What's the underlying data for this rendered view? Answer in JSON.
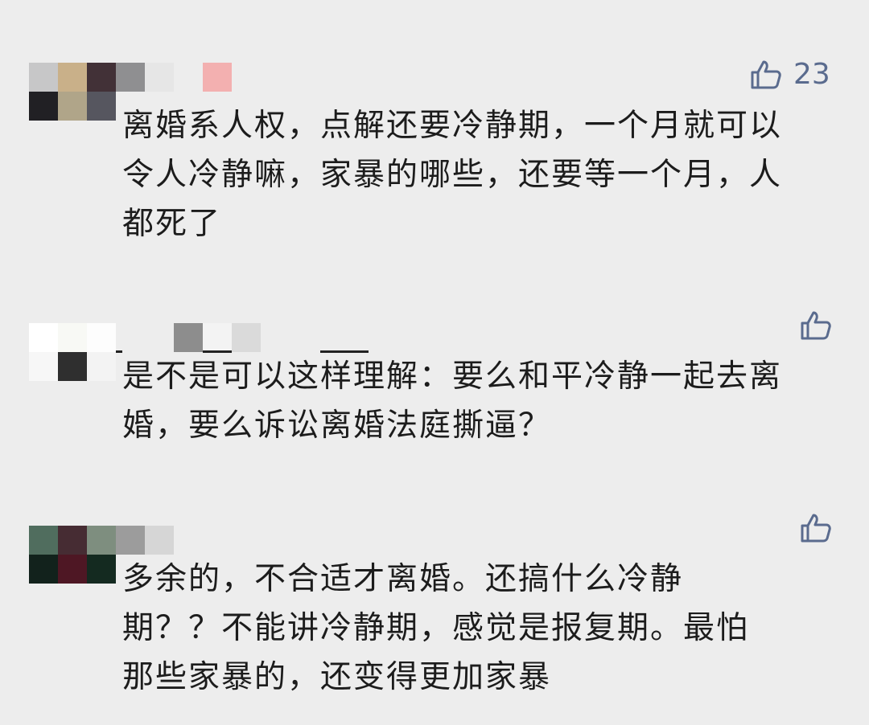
{
  "comments": [
    {
      "like_icon": "thumbs-up-icon",
      "like_count": "23",
      "text": "离婚系人权，点解还要冷静期，一个月就可以令人冷静嘛，家暴的哪些，还要等一个月，人都死了",
      "avatar_colors": [
        "#c7c7c8",
        "#c9b089",
        "#423137",
        "#8f8f91",
        "#212024",
        "#b0a589",
        "#56565f",
        "#ededed"
      ],
      "name_colors": [
        "#e6e6e6",
        "#ededed",
        "#f3b0b0"
      ]
    },
    {
      "like_icon": "thumbs-up-icon",
      "like_count": "",
      "text": "是不是可以这样理解：要么和平冷静一起去离婚，要么诉讼离婚法庭撕逼？",
      "avatar_colors": [
        "#ffffff",
        "#f8f9f5",
        "#fdfdfd",
        "#ededed",
        "#f7f7f7",
        "#2f2f2f",
        "#f3f3f3",
        "#ededed"
      ],
      "name_colors": [
        "#8d8d8d",
        "#f3f3f3",
        "#dadada"
      ]
    },
    {
      "like_icon": "thumbs-up-icon",
      "like_count": "",
      "text": "多余的，不合适才离婚。还搞什么冷静期？？不能讲冷静期，感觉是报复期。最怕那些家暴的，还变得更加家暴",
      "avatar_colors": [
        "#506d5e",
        "#462c33",
        "#7e8e7f",
        "#9c9c9c",
        "#12221c",
        "#4e1724",
        "#142a20",
        "#ededed"
      ],
      "name_colors": [
        "#d6d6d6",
        "#ededed",
        "#ededed"
      ]
    }
  ],
  "colors": {
    "background": "#ededed",
    "text": "#1c1c1c",
    "like_accent": "#5a6b8e"
  }
}
